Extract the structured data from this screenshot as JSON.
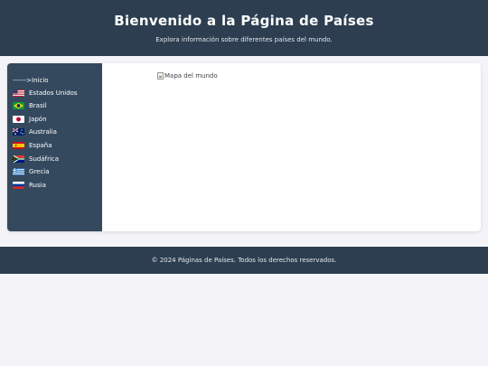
{
  "header": {
    "title": "Bienvenido a la Página de Países",
    "subtitle": "Explora información sobre diferentes países del mundo."
  },
  "nav": {
    "home_label": "------>Inicio",
    "items": [
      {
        "label": "Estados Unidos",
        "flag": "flag-usa"
      },
      {
        "label": "Brasil",
        "flag": "flag-brazil"
      },
      {
        "label": "Japón",
        "flag": "flag-japan"
      },
      {
        "label": "Australia",
        "flag": "flag-australia"
      },
      {
        "label": "España",
        "flag": "flag-spain"
      },
      {
        "label": "Sudáfrica",
        "flag": "flag-south-africa"
      },
      {
        "label": "Grecia",
        "flag": "flag-greece"
      },
      {
        "label": "Rusia",
        "flag": "flag-russia"
      }
    ]
  },
  "main": {
    "map_alt": "Mapa del mundo"
  },
  "footer": {
    "text": "© 2024 Páginas de Países. Todos los derechos reservados."
  },
  "colors": {
    "header_bg": "#2c3e50",
    "sidebar_bg": "#34495e",
    "page_bg": "#f4f4f8"
  }
}
